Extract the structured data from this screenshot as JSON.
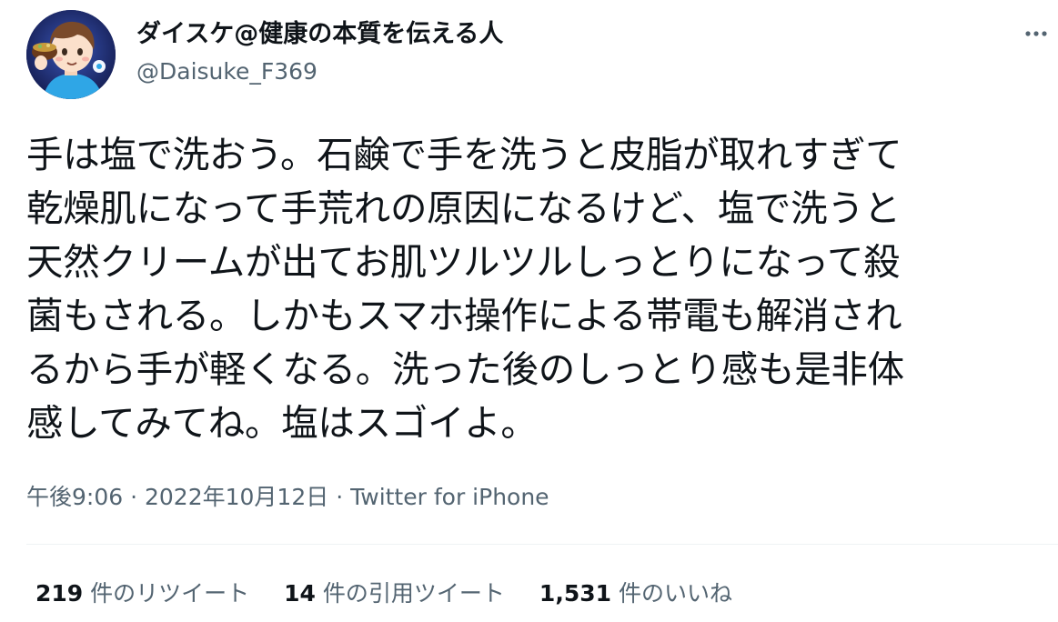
{
  "tweet": {
    "author": {
      "display_name": "ダイスケ@健康の本質を伝える人",
      "handle": "@Daisuke_F369"
    },
    "more_icon": "more-horizontal-icon",
    "text_lines": [
      "手は塩で洗おう。石鹸で手を洗うと皮脂が取れすぎて",
      "乾燥肌になって手荒れの原因になるけど、塩で洗うと",
      "天然クリームが出てお肌ツルツルしっとりになって殺",
      "菌もされる。しかもスマホ操作による帯電も解消され",
      "るから手が軽くなる。洗った後のしっとり感も是非体",
      "感してみてね。塩はスゴイよ。"
    ],
    "meta": {
      "time": "午後9:06",
      "separator": "·",
      "date": "2022年10月12日",
      "source": "Twitter for iPhone"
    },
    "stats": [
      {
        "count": "219",
        "label": "件のリツイート"
      },
      {
        "count": "14",
        "label": "件の引用ツイート"
      },
      {
        "count": "1,531",
        "label": "件のいいね"
      }
    ]
  }
}
